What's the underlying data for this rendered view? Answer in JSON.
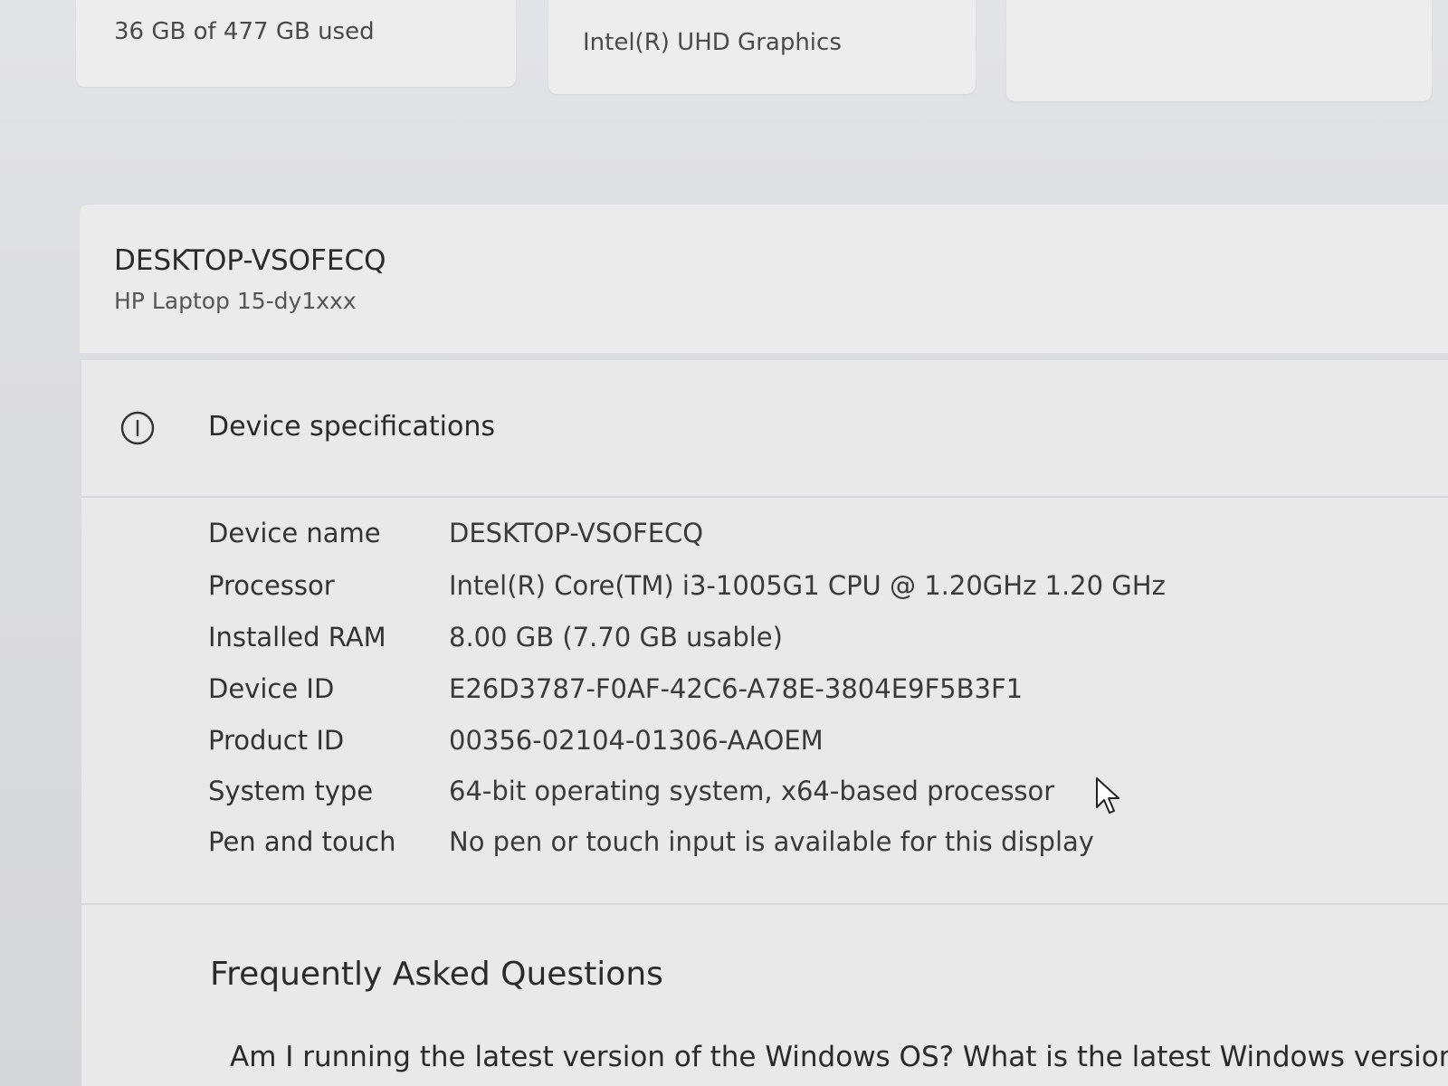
{
  "tiles": {
    "storage": {
      "text": "36 GB of 477 GB used"
    },
    "graphics": {
      "text": "Intel(R) UHD Graphics"
    },
    "third": {
      "text": ""
    }
  },
  "device": {
    "name": "DESKTOP-VSOFECQ",
    "model": "HP Laptop 15-dy1xxx"
  },
  "specs": {
    "icon": "info-circle-icon",
    "title": "Device specifications",
    "rows": [
      {
        "label": "Device name",
        "value": "DESKTOP-VSOFECQ"
      },
      {
        "label": "Processor",
        "value": "Intel(R) Core(TM) i3-1005G1 CPU @ 1.20GHz   1.20 GHz"
      },
      {
        "label": "Installed RAM",
        "value": "8.00 GB (7.70 GB usable)"
      },
      {
        "label": "Device ID",
        "value": "E26D3787-F0AF-42C6-A78E-3804E9F5B3F1"
      },
      {
        "label": "Product ID",
        "value": "00356-02104-01306-AAOEM"
      },
      {
        "label": "System type",
        "value": "64-bit operating system, x64-based processor"
      },
      {
        "label": "Pen and touch",
        "value": "No pen or touch input is available for this display"
      }
    ]
  },
  "faq": {
    "title": "Frequently Asked Questions",
    "question": "Am I running the latest version of the Windows OS? What is the latest Windows version?"
  },
  "cursor_icon": "mouse-pointer-icon"
}
